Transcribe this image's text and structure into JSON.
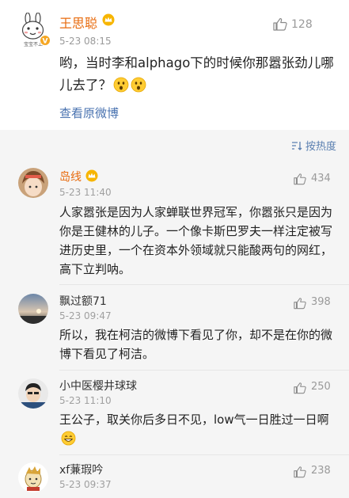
{
  "post": {
    "username": "王思聪",
    "time": "5-23 08:15",
    "likes": "128",
    "text": "哟，当时李和alphago下的时候你那嚣张劲儿哪儿去了？",
    "link": "查看原微博",
    "avatar_caption": "宝宝不上"
  },
  "sort_label": "按热度",
  "comments": [
    {
      "username": "岛线",
      "time": "5-23 11:40",
      "likes": "434",
      "text": "人家嚣张是因为人家蝉联世界冠军，你嚣张只是因为你是王健林的儿子。一个像卡斯巴罗夫一样注定被写进历史里，一个在资本外领域就只能酸两句的网红，高下立判呐。"
    },
    {
      "username": "飘过额71",
      "time": "5-23 09:47",
      "likes": "398",
      "text": "所以，我在柯洁的微博下看见了你，却不是在你的微博下看见了柯洁。"
    },
    {
      "username": "小中医樱井球球",
      "time": "5-23 11:10",
      "likes": "250",
      "text": "王公子，取关你后多日不见，low气一日胜过一日啊"
    },
    {
      "username": "xf蒹瑕吟",
      "time": "5-23 09:37",
      "likes": "238",
      "text": ""
    }
  ],
  "colors": {
    "orange": "#e86b0e",
    "link": "#4a73b0",
    "gray": "#9a9a9a"
  }
}
